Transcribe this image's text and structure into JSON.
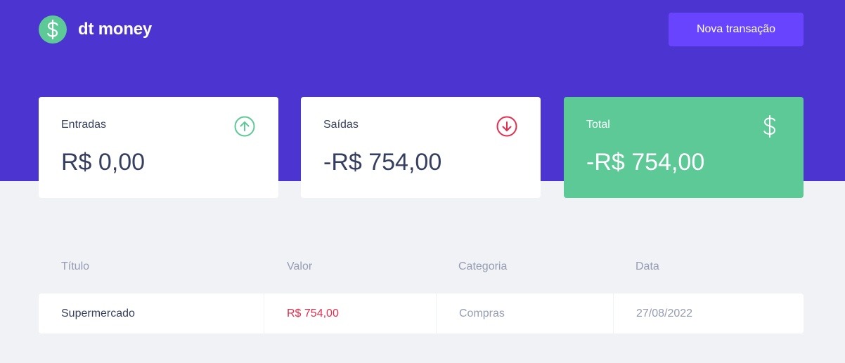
{
  "app": {
    "name": "dt money",
    "new_transaction_label": "Nova transação"
  },
  "summary": {
    "income": {
      "label": "Entradas",
      "amount": "R$ 0,00",
      "icon": "arrow-up-circle-icon"
    },
    "outcome": {
      "label": "Saídas",
      "amount": "-R$ 754,00",
      "icon": "arrow-down-circle-icon"
    },
    "total": {
      "label": "Total",
      "amount": "-R$ 754,00",
      "icon": "dollar-sign-icon"
    }
  },
  "table": {
    "headers": [
      "Título",
      "Valor",
      "Categoria",
      "Data"
    ],
    "rows": [
      {
        "title": "Supermercado",
        "value": "R$ 754,00",
        "category": "Compras",
        "date": "27/08/2022"
      }
    ]
  },
  "colors": {
    "header_bg": "#4b34cf",
    "button_bg": "#6944ff",
    "green": "#5cc996",
    "red": "#e52e4d",
    "text_title": "#363f5f",
    "text_body": "#969cb3",
    "page_bg": "#f0f2f5"
  }
}
